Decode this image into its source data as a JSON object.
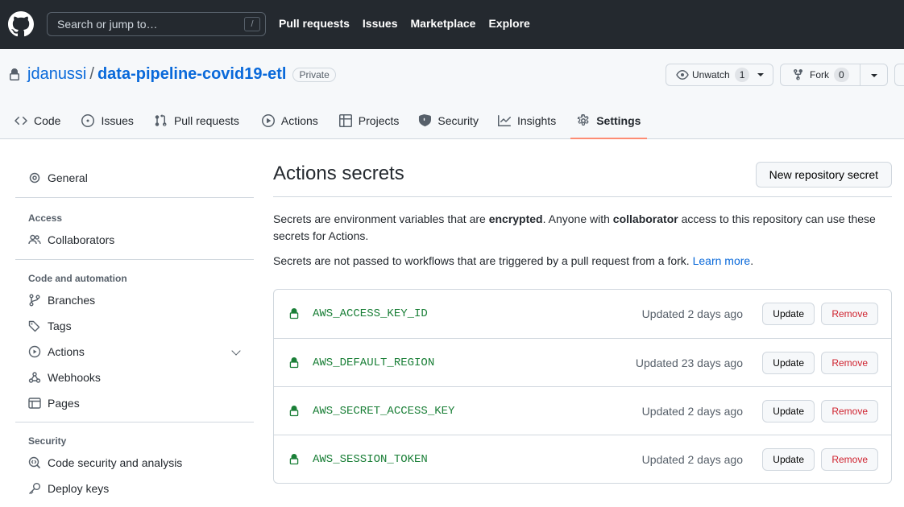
{
  "header": {
    "search_placeholder": "Search or jump to…",
    "search_shortcut": "/",
    "nav": [
      "Pull requests",
      "Issues",
      "Marketplace",
      "Explore"
    ]
  },
  "repo": {
    "owner": "jdanussi",
    "separator": "/",
    "name": "data-pipeline-covid19-etl",
    "visibility": "Private",
    "unwatch_label": "Unwatch",
    "watch_count": "1",
    "fork_label": "Fork",
    "fork_count": "0"
  },
  "tabs": [
    {
      "label": "Code",
      "icon": "code-icon"
    },
    {
      "label": "Issues",
      "icon": "issue-icon"
    },
    {
      "label": "Pull requests",
      "icon": "pull-request-icon"
    },
    {
      "label": "Actions",
      "icon": "play-icon"
    },
    {
      "label": "Projects",
      "icon": "table-icon"
    },
    {
      "label": "Security",
      "icon": "shield-icon"
    },
    {
      "label": "Insights",
      "icon": "graph-icon"
    },
    {
      "label": "Settings",
      "icon": "gear-icon",
      "selected": true
    }
  ],
  "sidebar": {
    "general": "General",
    "access_title": "Access",
    "collaborators": "Collaborators",
    "automation_title": "Code and automation",
    "branches": "Branches",
    "tags": "Tags",
    "actions": "Actions",
    "webhooks": "Webhooks",
    "pages": "Pages",
    "security_title": "Security",
    "code_security": "Code security and analysis",
    "deploy_keys": "Deploy keys"
  },
  "main": {
    "title": "Actions secrets",
    "new_secret_button": "New repository secret",
    "p1_a": "Secrets are environment variables that are ",
    "p1_b": "encrypted",
    "p1_c": ". Anyone with ",
    "p1_d": "collaborator",
    "p1_e": " access to this repository can use these secrets for Actions.",
    "p2_a": "Secrets are not passed to workflows that are triggered by a pull request from a fork. ",
    "p2_link": "Learn more",
    "p2_end": "."
  },
  "secrets": [
    {
      "name": "AWS_ACCESS_KEY_ID",
      "updated": "Updated 2 days ago",
      "update": "Update",
      "remove": "Remove"
    },
    {
      "name": "AWS_DEFAULT_REGION",
      "updated": "Updated 23 days ago",
      "update": "Update",
      "remove": "Remove"
    },
    {
      "name": "AWS_SECRET_ACCESS_KEY",
      "updated": "Updated 2 days ago",
      "update": "Update",
      "remove": "Remove"
    },
    {
      "name": "AWS_SESSION_TOKEN",
      "updated": "Updated 2 days ago",
      "update": "Update",
      "remove": "Remove"
    }
  ],
  "colors": {
    "header_bg": "#24292f",
    "link": "#0969da",
    "secret_name": "#1a7f37",
    "danger": "#cf222e",
    "tab_underline": "#fd8c73"
  }
}
